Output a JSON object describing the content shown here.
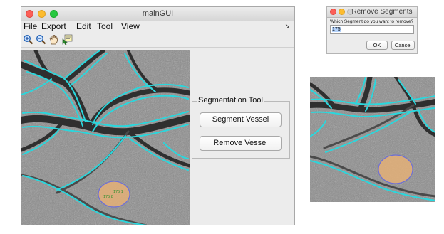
{
  "main_window": {
    "title": "mainGUI",
    "menu": [
      "File",
      "Export",
      "Edit",
      "Tool",
      "View"
    ],
    "toolbar_icons": [
      "zoom-in-icon",
      "zoom-out-icon",
      "pan-hand-icon",
      "data-cursor-icon"
    ],
    "image_labels": [
      "175 1",
      "175 8"
    ]
  },
  "segmentation_panel": {
    "legend": "Segmentation Tool",
    "segment_button": "Segment Vessel",
    "remove_button": "Remove Vessel"
  },
  "dialog": {
    "title": "Remove Segments",
    "prompt": "Which Segment do you want to remove?",
    "input_value": "175",
    "ok_label": "OK",
    "cancel_label": "Cancel"
  },
  "colors": {
    "vessel_overlay": "#2ad7dd",
    "selection_ellipse": "#e9b176",
    "window_bg": "#ececec"
  }
}
